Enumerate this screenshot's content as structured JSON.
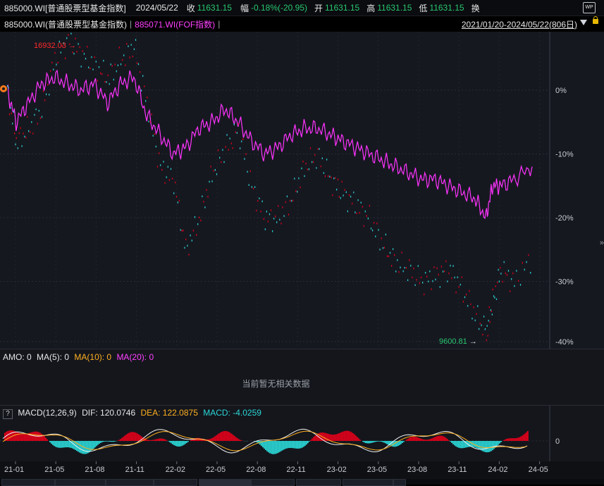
{
  "header": {
    "code": "885000.WI[普通股票型基金指数]",
    "date": "2024/05/22",
    "close_label": "收",
    "close_value": "11631.15",
    "change_label": "幅",
    "change_value": "-0.18%(-20.95)",
    "open_label": "开",
    "open_value": "11631.15",
    "high_label": "高",
    "high_value": "11631.15",
    "low_label": "低",
    "low_value": "11631.15",
    "swap_label": "换",
    "badge": "WP"
  },
  "legend": {
    "main": "885000.WI(普通股票型基金指数)",
    "compare": "885071.WI(FOF指数)",
    "range": "2021/01/20-2024/05/22(806日)"
  },
  "colors": {
    "main_up": "#e0001a",
    "main_down": "#2bd6d6",
    "compare": "#ff33ff",
    "dif": "#f2f2f2",
    "dea": "#ffb020"
  },
  "annotations": {
    "high": "16932.03",
    "low": "9600.81"
  },
  "axes": {
    "pct_ticks": [
      "0%",
      "-10%",
      "-20%",
      "-30%",
      "-40%"
    ],
    "date_ticks": [
      "21-01",
      "21-05",
      "21-08",
      "21-11",
      "22-02",
      "22-05",
      "22-08",
      "22-11",
      "23-02",
      "23-05",
      "23-08",
      "23-11",
      "24-02",
      "24-05"
    ]
  },
  "amo": {
    "label": "AMO:",
    "value": "0",
    "ma5": "MA(5): 0",
    "ma10": "MA(10): 0",
    "ma20": "MA(20): 0",
    "empty": "当前暂无相关数据"
  },
  "macd": {
    "help": "?",
    "name": "MACD(12,26,9)",
    "dif": "DIF: 120.0746",
    "dea": "DEA: 122.0875",
    "macd": "MACD: -4.0259",
    "zero": "0"
  },
  "chart_data": {
    "type": "line",
    "x": [
      "2021-01-20",
      "2021-02-10",
      "2021-03-10",
      "2021-04-10",
      "2021-05-10",
      "2021-06-10",
      "2021-07-10",
      "2021-08-10",
      "2021-09-10",
      "2021-10-10",
      "2021-11-10",
      "2021-12-10",
      "2022-01-10",
      "2022-02-10",
      "2022-03-10",
      "2022-04-10",
      "2022-05-10",
      "2022-06-10",
      "2022-07-10",
      "2022-08-10",
      "2022-09-10",
      "2022-10-10",
      "2022-11-10",
      "2022-12-10",
      "2023-01-10",
      "2023-02-10",
      "2023-03-10",
      "2023-04-10",
      "2023-05-10",
      "2023-06-10",
      "2023-07-10",
      "2023-08-10",
      "2023-09-10",
      "2023-10-10",
      "2023-11-10",
      "2023-12-10",
      "2024-01-10",
      "2024-02-05",
      "2024-02-20",
      "2024-03-10",
      "2024-04-10",
      "2024-05-22"
    ],
    "series": [
      {
        "name": "885000.WI(普通股票型基金指数)",
        "values": [
          0,
          -8,
          -6,
          -3,
          5,
          8,
          6,
          4,
          2,
          5,
          7,
          -2,
          -12,
          -14,
          -25,
          -20,
          -13,
          -9,
          -6,
          -15,
          -20,
          -20,
          -17,
          -12,
          -10,
          -14,
          -16,
          -18,
          -20,
          -24,
          -27,
          -28,
          -30,
          -29,
          -28,
          -31,
          -35,
          -38,
          -33,
          -28,
          -30,
          -26
        ]
      },
      {
        "name": "885071.WI(FOF指数)",
        "values": [
          0,
          -5,
          -2,
          1,
          2,
          1,
          0,
          1,
          -2,
          1,
          2,
          -4,
          -7,
          -10,
          -9,
          -6,
          -5,
          -3,
          -5,
          -8,
          -10,
          -9,
          -7,
          -6,
          -6,
          -7,
          -8,
          -9,
          -10,
          -11,
          -12,
          -13,
          -14,
          -14,
          -15,
          -16,
          -17,
          -20,
          -15,
          -15,
          -14,
          -12
        ]
      }
    ],
    "ylim": [
      -40,
      7
    ],
    "macd_zero": 0
  }
}
